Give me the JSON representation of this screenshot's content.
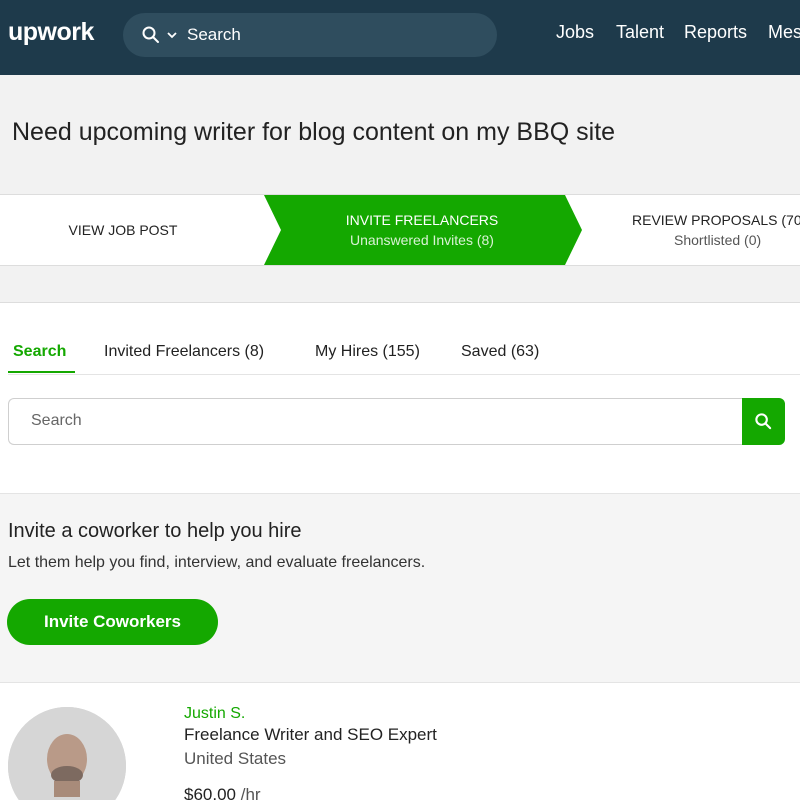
{
  "nav": {
    "logo": "upwork",
    "search_placeholder": "Search",
    "links": [
      "Jobs",
      "Talent",
      "Reports",
      "Mes"
    ]
  },
  "job": {
    "title": "Need upcoming writer for blog content on my BBQ site"
  },
  "steps": [
    {
      "label": "VIEW JOB POST",
      "sub": ""
    },
    {
      "label": "INVITE FREELANCERS",
      "sub": "Unanswered Invites (8)"
    },
    {
      "label": "REVIEW PROPOSALS (70",
      "sub": "Shortlisted (0)"
    }
  ],
  "tabs": [
    "Search",
    "Invited Freelancers (8)",
    "My Hires (155)",
    "Saved (63)"
  ],
  "search": {
    "placeholder": "Search"
  },
  "invite": {
    "title": "Invite a coworker to help you hire",
    "description": "Let them help you find, interview, and evaluate freelancers.",
    "button_label": "Invite Coworkers"
  },
  "freelancer": {
    "name": "Justin S.",
    "title": "Freelance Writer and SEO Expert",
    "location": "United States",
    "rate": "$60.00",
    "rate_unit": " /hr"
  },
  "colors": {
    "brand_green": "#14a800",
    "nav_bg": "#1e3a4b"
  }
}
